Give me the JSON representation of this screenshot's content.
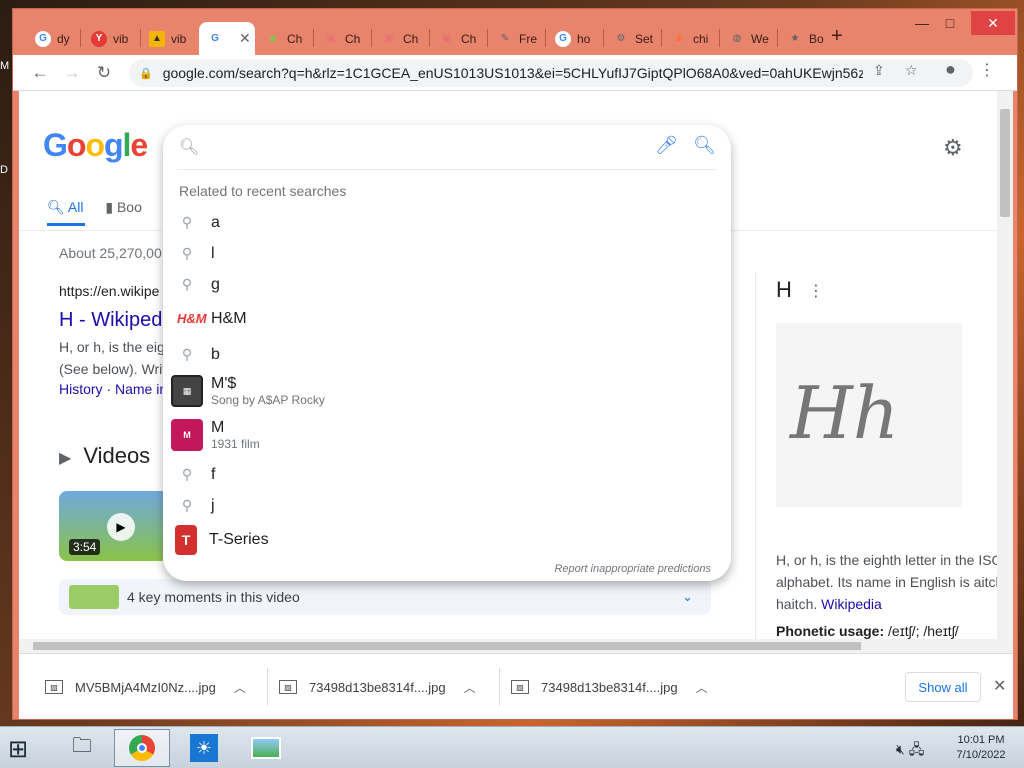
{
  "desktop": {
    "side_letters": [
      "M",
      "D"
    ]
  },
  "tabs": [
    {
      "title": "dy",
      "favicon": "google-icon",
      "color": "#4285f4",
      "glyph": "G"
    },
    {
      "title": "vib",
      "favicon": "yandex-icon",
      "color": "#e53935",
      "glyph": "Y"
    },
    {
      "title": "vib",
      "favicon": "image-icon",
      "color": "#f4b400",
      "glyph": "▲"
    },
    {
      "title": "",
      "favicon": "google-icon",
      "color": "#4285f4",
      "glyph": "G",
      "active": true
    },
    {
      "title": "Ch",
      "favicon": "leaf-icon",
      "color": "#8bc34a",
      "glyph": "◆"
    },
    {
      "title": "Ch",
      "favicon": "chrome-store-icon",
      "color": "#e57373",
      "glyph": "▣"
    },
    {
      "title": "Ch",
      "favicon": "chrome-store-icon",
      "color": "#e57373",
      "glyph": "▣"
    },
    {
      "title": "Ch",
      "favicon": "chrome-store-icon",
      "color": "#e57373",
      "glyph": "▣"
    },
    {
      "title": "Fre",
      "favicon": "pin-icon",
      "color": "#9e9e9e",
      "glyph": "✎"
    },
    {
      "title": "ho",
      "favicon": "google-icon",
      "color": "#4285f4",
      "glyph": "G"
    },
    {
      "title": "Set",
      "favicon": "gear-icon",
      "color": "#5f6368",
      "glyph": "⚙"
    },
    {
      "title": "chi",
      "favicon": "figure-icon",
      "color": "#ff7043",
      "glyph": "♟"
    },
    {
      "title": "We",
      "favicon": "globe-icon",
      "color": "#5f6368",
      "glyph": "◍"
    },
    {
      "title": "Bo",
      "favicon": "star-icon",
      "color": "#5f6368",
      "glyph": "★"
    }
  ],
  "window_controls": {
    "minimize": "—",
    "maximize": "□",
    "close": "✕"
  },
  "toolbar": {
    "back": "←",
    "forward": "→",
    "reload": "↻",
    "url": "google.com/search?q=h&rlz=1C1GCEA_enUS1013US1013&ei=5CHLYufIJ7GiptQPlO68A0&ved=0ahUKEwjn56z...",
    "share": "⇪",
    "bookmark": "☆",
    "profile": "●",
    "menu": "⋮"
  },
  "page": {
    "logo": [
      "G",
      "o",
      "o",
      "g",
      "l",
      "e"
    ],
    "logo_colors": [
      "#4285f4",
      "#ea4335",
      "#fbbc05",
      "#4285f4",
      "#34a853",
      "#ea4335"
    ],
    "tab_all": "All",
    "tab_books": "Boo",
    "stats": "About 25,270,00",
    "cite": "https://en.wikipe",
    "result_title": "H - Wikipedi",
    "snippet_1": "H, or h, is the eigh",
    "snippet_2": "(See below). Writ",
    "links": "History · Name in",
    "videos_heading": "Videos",
    "video_duration": "3:54",
    "key_moments": "4 key moments in this video",
    "kp_title": "H",
    "kp_letters": "Hh",
    "kp_desc": "H, or h, is the eighth letter in the ISO l alphabet. Its name in English is aitch haitch.",
    "kp_wiki": "Wikipedia",
    "kp_phonetic_label": "Phonetic usage:",
    "kp_phonetic_value": "/eɪtʃ/; /heɪtʃ/"
  },
  "dropdown": {
    "related_label": "Related to recent searches",
    "suggestions": [
      {
        "text": "a",
        "icon": "search-icon"
      },
      {
        "text": "l",
        "icon": "search-icon"
      },
      {
        "text": "g",
        "icon": "search-icon"
      },
      {
        "text": "H&M",
        "icon": "hm-logo-icon"
      },
      {
        "text": "b",
        "icon": "search-icon"
      },
      {
        "text": "M'$",
        "sub": "Song by A$AP Rocky",
        "icon": "album-thumb-icon"
      },
      {
        "text": "M",
        "sub": "1931 film",
        "icon": "film-thumb-icon"
      },
      {
        "text": "f",
        "icon": "search-icon"
      },
      {
        "text": "j",
        "icon": "search-icon"
      },
      {
        "text": "T-Series",
        "icon": "tseries-logo-icon"
      }
    ],
    "report": "Report inappropriate predictions"
  },
  "downloads": {
    "items": [
      {
        "name": "MV5BMjA4MzI0Nz....jpg"
      },
      {
        "name": "73498d13be8314f....jpg"
      },
      {
        "name": "73498d13be8314f....jpg"
      }
    ],
    "show_all": "Show all",
    "close": "✕"
  },
  "taskbar": {
    "time": "10:01 PM",
    "date": "7/10/2022"
  }
}
